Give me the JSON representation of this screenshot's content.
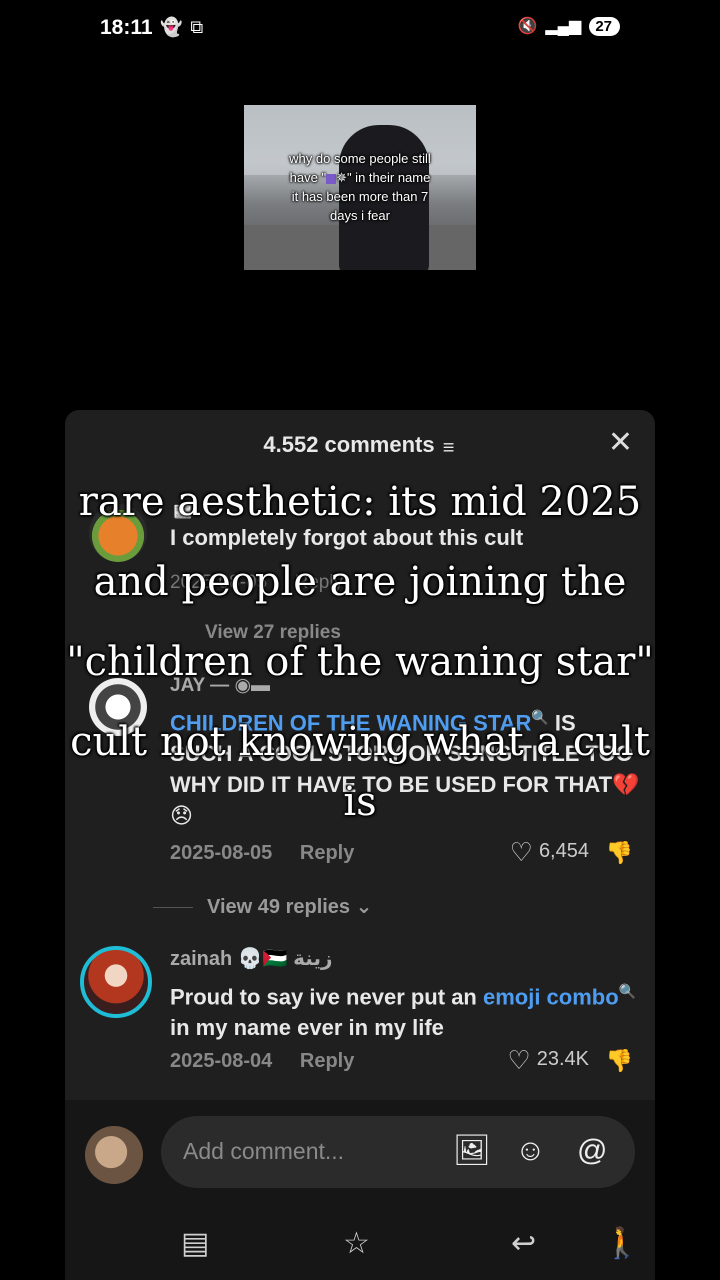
{
  "status_bar": {
    "time": "18:11",
    "battery": "27"
  },
  "video": {
    "caption_line1": "why do some people still",
    "caption_line2_a": "have \"",
    "caption_line2_b": "✵\" in their name",
    "caption_line3": "it has been more than 7",
    "caption_line4": "days i fear"
  },
  "comments_sheet": {
    "title": "4.552 comments",
    "comments": [
      {
        "text": "I completely forgot about this cult",
        "date": "2025-08-05",
        "reply": "Reply",
        "view_replies": "View 27 replies"
      },
      {
        "user": "JAY —",
        "text_hl": "CHILDREN OF THE WANING STAR",
        "text_rest": " IS SUCH A COOL STORY OR SONG TITLE TOO WHY DID IT HAVE TO BE USED FOR THAT💔😞",
        "date": "2025-08-05",
        "reply": "Reply",
        "likes": "6,454",
        "view_replies": "View 49 replies"
      },
      {
        "user": "zainah 💀🇵🇸 زينة",
        "text_a": "Proud to say ive never put an ",
        "text_hl": "emoji combo",
        "text_b": " in my name ever in my life",
        "date": "2025-08-04",
        "reply": "Reply",
        "likes": "23.4K"
      }
    ],
    "composer_placeholder": "Add comment..."
  },
  "overlay_caption": {
    "line1": "rare aesthetic: its mid 2025",
    "line2": "and people are joining the",
    "line3": "\"children of the waning star\"",
    "line4": "cult not knowing what a cult",
    "line5": "is"
  }
}
